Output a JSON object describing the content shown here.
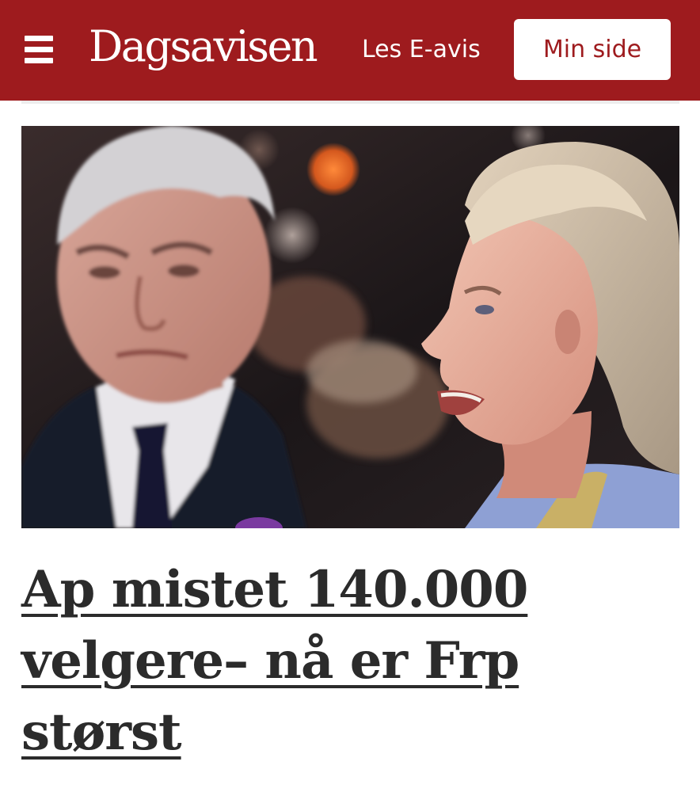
{
  "header": {
    "logo": "Dagsavisen",
    "eavis_link": "Les E-avis",
    "min_side_button": "Min side",
    "background_color": "#9e1b1e"
  },
  "icons": {
    "menu": "hamburger-menu-icon"
  },
  "article": {
    "headline": "Ap mistet 140.000 velgere– nå er Frp størst"
  }
}
